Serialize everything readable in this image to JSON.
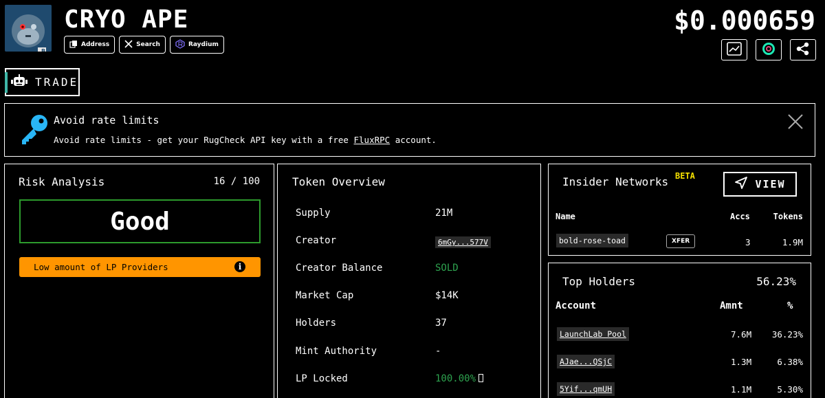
{
  "header": {
    "token_name": "CRYO APE",
    "price": "$0.000659",
    "buttons": [
      {
        "label": "Address",
        "icon": "copy-icon"
      },
      {
        "label": "Search",
        "icon": "x-logo-icon"
      },
      {
        "label": "Raydium",
        "icon": "raydium-logo-icon"
      }
    ],
    "action_icons": [
      "chart-icon",
      "birdeye-icon",
      "share-icon"
    ],
    "trade_label": "TRADE"
  },
  "banner": {
    "title": "Avoid rate limits",
    "text_before": "Avoid rate limits - get your RugCheck API key with a free ",
    "link": "FluxRPC",
    "text_after": " account.",
    "icon": "key-icon"
  },
  "risk": {
    "title": "Risk Analysis",
    "score": "16 / 100",
    "rating": "Good",
    "items": [
      {
        "label": "Low amount of LP Providers",
        "icon": "info-icon",
        "color": "#ff9500"
      }
    ]
  },
  "overview": {
    "title": "Token Overview",
    "rows": [
      {
        "label": "Supply",
        "value": "21M"
      },
      {
        "label": "Creator",
        "value": "6mGy...577V"
      },
      {
        "label": "Creator Balance",
        "value": "SOLD"
      },
      {
        "label": "Market Cap",
        "value": "$14K"
      },
      {
        "label": "Holders",
        "value": "37"
      },
      {
        "label": "Mint Authority",
        "value": "-"
      },
      {
        "label": "LP Locked",
        "value": "100.00%"
      }
    ]
  },
  "insider": {
    "title": "Insider Networks",
    "badge": "BETA",
    "view_label": "VIEW",
    "columns": [
      "Name",
      "Accs",
      "Tokens"
    ],
    "rows": [
      {
        "name": "bold-rose-toad",
        "tag": "XFER",
        "accs": "3",
        "tokens": "1.9M"
      }
    ]
  },
  "holders": {
    "title": "Top Holders",
    "total": "56.23%",
    "columns": [
      "Account",
      "Amnt",
      "%"
    ],
    "rows": [
      {
        "account": "LaunchLab Pool",
        "amount": "7.6M",
        "pct": "36.23%"
      },
      {
        "account": "AJae...QSjC",
        "amount": "1.3M",
        "pct": "6.38%"
      },
      {
        "account": "5Yif...qmUH",
        "amount": "1.1M",
        "pct": "5.30%"
      }
    ]
  },
  "colors": {
    "good": "#2d9b2d",
    "warning": "#ff9500",
    "beta": "#f5e000",
    "positive": "#2ea34f"
  }
}
